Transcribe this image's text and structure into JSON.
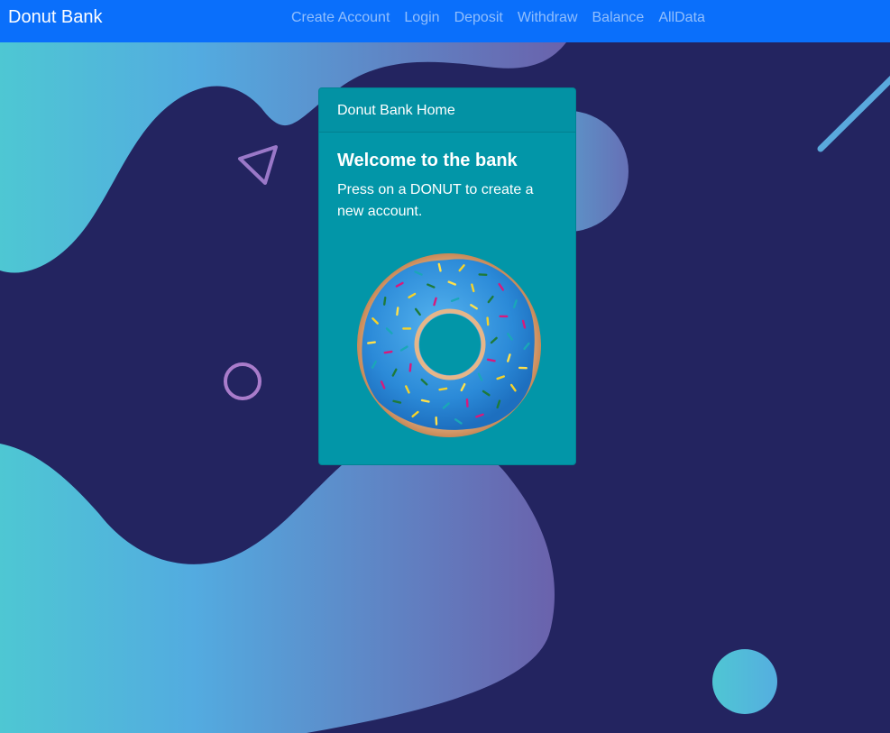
{
  "navbar": {
    "brand": "Donut Bank",
    "links": [
      {
        "label": "Create Account"
      },
      {
        "label": "Login"
      },
      {
        "label": "Deposit"
      },
      {
        "label": "Withdraw"
      },
      {
        "label": "Balance"
      },
      {
        "label": "AllData"
      }
    ]
  },
  "card": {
    "header": "Donut Bank Home",
    "title": "Welcome to the bank",
    "text": "Press on a DONUT to create a new account.",
    "donut_icon": "donut-icon"
  },
  "colors": {
    "navbar": "#0a6ffb",
    "page_background": "#232460",
    "card": "#0296a8",
    "frosting": "#2f8fdc"
  }
}
